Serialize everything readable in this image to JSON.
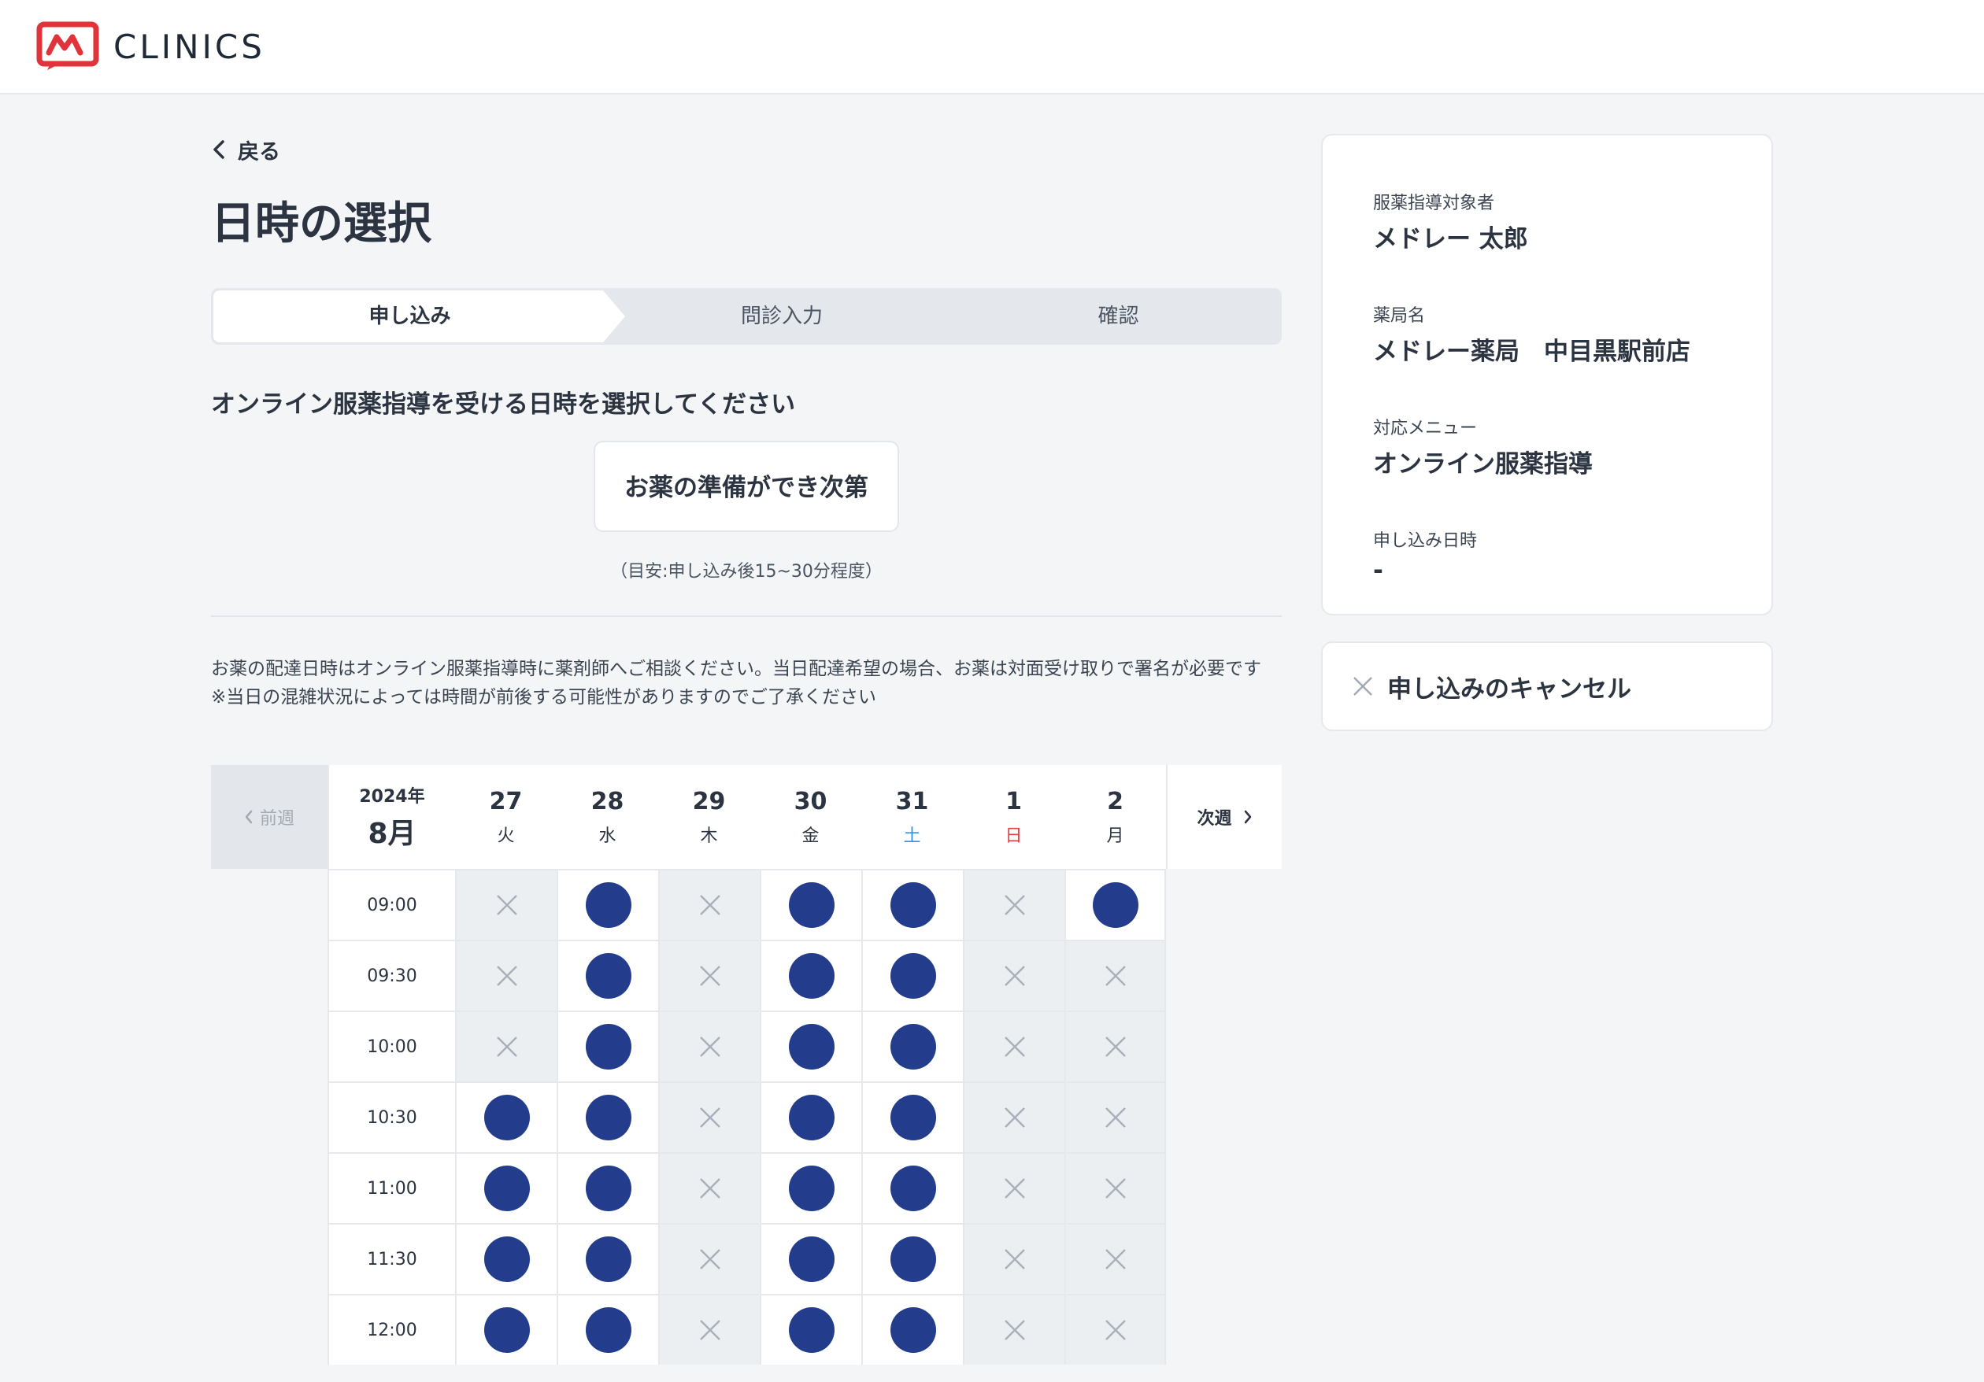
{
  "header": {
    "logo_text": "CLINICS",
    "brand_color": "#e0343a"
  },
  "nav": {
    "back_label": "戻る"
  },
  "page": {
    "title": "日時の選択"
  },
  "steps": [
    {
      "label": "申し込み",
      "active": true
    },
    {
      "label": "問診入力",
      "active": false
    },
    {
      "label": "確認",
      "active": false
    }
  ],
  "selection": {
    "instruction": "オンライン服薬指導を受ける日時を選択してください",
    "asap_button": "お薬の準備ができ次第",
    "asap_note": "（目安:申し込み後15~30分程度）"
  },
  "notes": {
    "line1": "お薬の配達日時はオンライン服薬指導時に薬剤師へご相談ください。当日配達希望の場合、お薬は対面受け取りで署名が必要です",
    "line2": "※当日の混雑状況によっては時間が前後する可能性がありますのでご了承ください"
  },
  "calendar": {
    "prev_label": "前週",
    "next_label": "次週",
    "year": "2024年",
    "month": "8月",
    "days": [
      {
        "date": "27",
        "weekday": "火",
        "type": "weekday"
      },
      {
        "date": "28",
        "weekday": "水",
        "type": "weekday"
      },
      {
        "date": "29",
        "weekday": "木",
        "type": "weekday"
      },
      {
        "date": "30",
        "weekday": "金",
        "type": "weekday"
      },
      {
        "date": "31",
        "weekday": "土",
        "type": "sat"
      },
      {
        "date": "1",
        "weekday": "日",
        "type": "sun"
      },
      {
        "date": "2",
        "weekday": "月",
        "type": "weekday"
      }
    ],
    "slots": [
      {
        "time": "09:00",
        "avail": [
          false,
          true,
          false,
          true,
          true,
          false,
          true
        ]
      },
      {
        "time": "09:30",
        "avail": [
          false,
          true,
          false,
          true,
          true,
          false,
          false
        ]
      },
      {
        "time": "10:00",
        "avail": [
          false,
          true,
          false,
          true,
          true,
          false,
          false
        ]
      },
      {
        "time": "10:30",
        "avail": [
          true,
          true,
          false,
          true,
          true,
          false,
          false
        ]
      },
      {
        "time": "11:00",
        "avail": [
          true,
          true,
          false,
          true,
          true,
          false,
          false
        ]
      },
      {
        "time": "11:30",
        "avail": [
          true,
          true,
          false,
          true,
          true,
          false,
          false
        ]
      },
      {
        "time": "12:00",
        "avail": [
          true,
          true,
          false,
          true,
          true,
          false,
          false
        ]
      }
    ],
    "available_color": "#233d8c",
    "saturday_color": "#3a8fde",
    "sunday_color": "#e0403f"
  },
  "summary": {
    "patient_label": "服薬指導対象者",
    "patient_value": "メドレー 太郎",
    "pharmacy_label": "薬局名",
    "pharmacy_value": "メドレー薬局　中目黒駅前店",
    "menu_label": "対応メニュー",
    "menu_value": "オンライン服薬指導",
    "datetime_label": "申し込み日時",
    "datetime_value": "-",
    "cancel_label": "申し込みのキャンセル"
  }
}
